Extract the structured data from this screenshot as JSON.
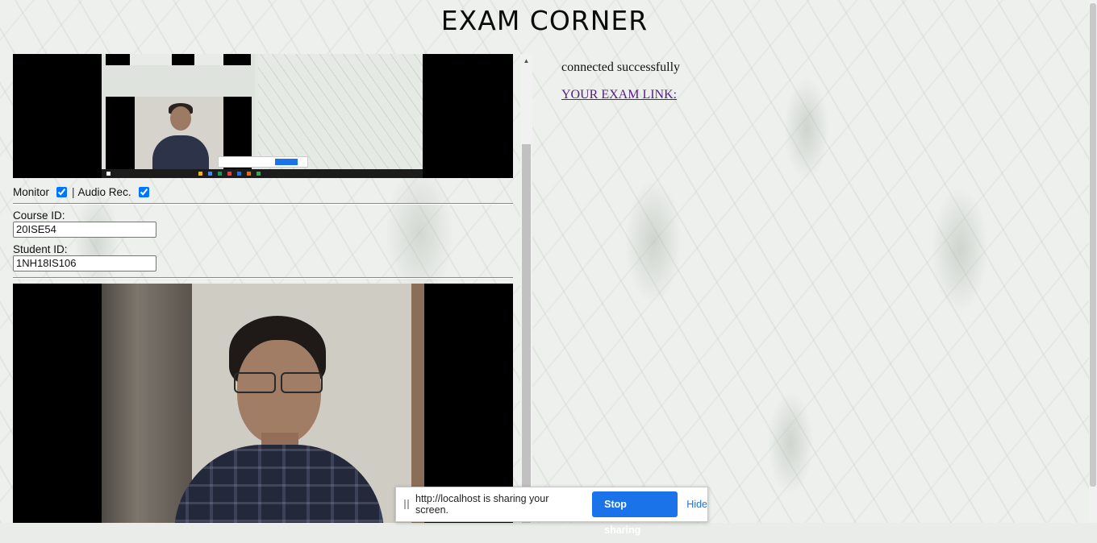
{
  "header": {
    "title": "EXAM CORNER"
  },
  "monitor": {
    "monitor_label": "Monitor",
    "monitor_checked": true,
    "separator": "|",
    "audio_label": "Audio Rec.",
    "audio_checked": true
  },
  "form": {
    "course_label": "Course ID:",
    "course_value": "20ISE54",
    "student_label": "Student ID:",
    "student_value": "1NH18IS106"
  },
  "right": {
    "status": "connected successfully",
    "exam_link": "YOUR EXAM LINK:"
  },
  "share_bar": {
    "message": "http://localhost is sharing your screen.",
    "stop_label": "Stop sharing",
    "hide_label": "Hide"
  },
  "colors": {
    "accent": "#1a73e8",
    "link_visited": "#551a8b",
    "video_bg": "#000000"
  }
}
